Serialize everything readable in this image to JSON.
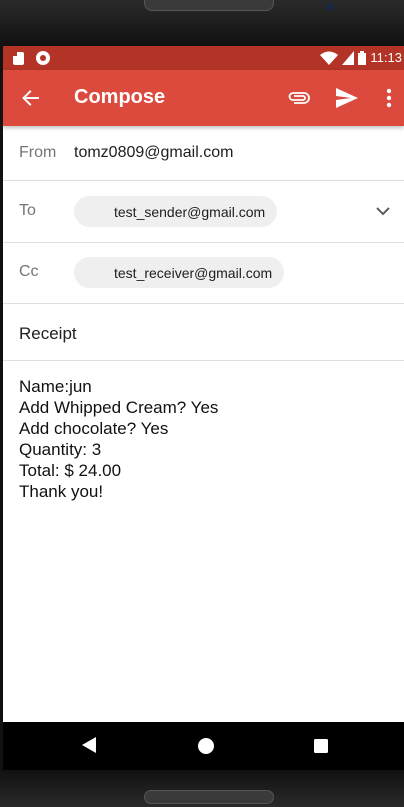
{
  "status_bar": {
    "time": "11:13",
    "icons": [
      "sd-card-icon",
      "record-icon",
      "wifi-icon",
      "signal-icon",
      "battery-icon"
    ]
  },
  "app_bar": {
    "title": "Compose",
    "icons": [
      "back-arrow-icon",
      "attachment-icon",
      "send-icon",
      "more-vert-icon"
    ],
    "color": "#dc4a3d",
    "status_color": "#b33427"
  },
  "compose": {
    "from_label": "From",
    "from_value": "tomz0809@gmail.com",
    "to_label": "To",
    "to_value": "test_sender@gmail.com",
    "cc_label": "Cc",
    "cc_value": "test_receiver@gmail.com",
    "subject": "Receipt",
    "body_lines": [
      "Name:jun",
      "Add Whipped Cream? Yes",
      "Add chocolate? Yes",
      "Quantity: 3",
      "Total: $ 24.00",
      "Thank you!"
    ]
  },
  "nav_bar": {
    "icons": [
      "back-triangle-icon",
      "home-circle-icon",
      "recents-square-icon"
    ]
  }
}
